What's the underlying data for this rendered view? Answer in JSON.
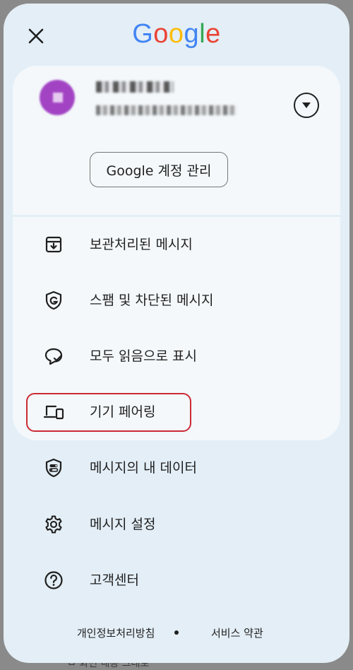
{
  "header": {
    "logo_letters": [
      "G",
      "o",
      "o",
      "g",
      "l",
      "e"
    ],
    "logo_colors": [
      "#4285F4",
      "#EA4335",
      "#FBBC05",
      "#4285F4",
      "#34A853",
      "#EA4335"
    ]
  },
  "account": {
    "manage_label": "Google 계정 관리"
  },
  "menu": {
    "items": [
      {
        "label": "보관처리된 메시지",
        "icon": "archive-icon"
      },
      {
        "label": "스팸 및 차단된 메시지",
        "icon": "shield-g-icon"
      },
      {
        "label": "모두 읽음으로 표시",
        "icon": "chat-check-icon"
      },
      {
        "label": "기기 페어링",
        "icon": "devices-icon"
      },
      {
        "label": "메시지의 내 데이터",
        "icon": "shield-toggle-icon"
      },
      {
        "label": "메시지 설정",
        "icon": "gear-icon"
      },
      {
        "label": "고객센터",
        "icon": "help-icon"
      }
    ]
  },
  "footer": {
    "privacy_label": "개인정보처리방침",
    "terms_label": "서비스 약관"
  },
  "colors": {
    "sheet_bg": "#e3eef6",
    "card_bg": "#f4f8fb",
    "highlight": "#cc2a35",
    "avatar": "#a243c4"
  }
}
